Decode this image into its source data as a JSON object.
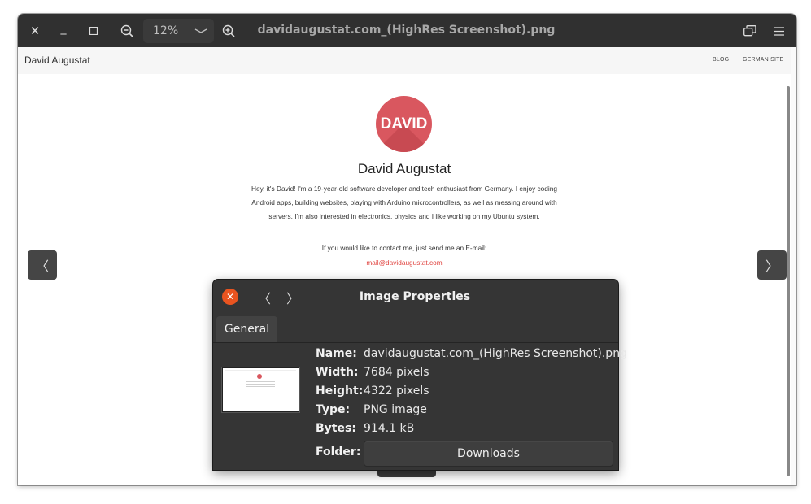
{
  "viewer": {
    "title": "davidaugustat.com_(HighRes Screenshot).png",
    "zoom": "12%",
    "buttons": {
      "close_icon": "close-icon",
      "minimize_icon": "minimize-icon",
      "maximize_icon": "maximize-icon",
      "zoom_out_icon": "zoom-out-icon",
      "zoom_in_icon": "zoom-in-icon",
      "zoom_dropdown_icon": "chevron-down-icon",
      "fit_icon": "fit-window-icon",
      "menu_icon": "hamburger-menu-icon",
      "prev_icon": "chevron-left-icon",
      "next_icon": "chevron-right-icon"
    }
  },
  "website": {
    "site_name": "David Augustat",
    "nav": [
      "BLOG",
      "GERMAN SITE"
    ],
    "avatar_text": "DAVID",
    "heading": "David Augustat",
    "bio_lines": [
      "Hey, it's David! I'm a 19-year-old software developer and tech enthusiast from Germany. I enjoy coding",
      "Android apps, building websites, playing with Arduino microcontrollers, as well as messing around with",
      "servers. I'm also interested in electronics, physics and I like working on my Ubuntu system."
    ],
    "contact_text": "If you would like to contact me, just send me an E-mail:",
    "email": "mail@davidaugustat.com",
    "accent_color": "#d9575f"
  },
  "dialog": {
    "title": "Image Properties",
    "tab": "General",
    "properties": [
      {
        "label": "Name:",
        "value": "davidaugustat.com_(HighRes Screenshot).png"
      },
      {
        "label": "Width:",
        "value": "7684 pixels"
      },
      {
        "label": "Height:",
        "value": "4322 pixels"
      },
      {
        "label": "Type:",
        "value": "PNG image"
      },
      {
        "label": "Bytes:",
        "value": "914.1 kB"
      }
    ],
    "folder_label": "Folder:",
    "folder_button": "Downloads",
    "close_color": "#e95420"
  }
}
